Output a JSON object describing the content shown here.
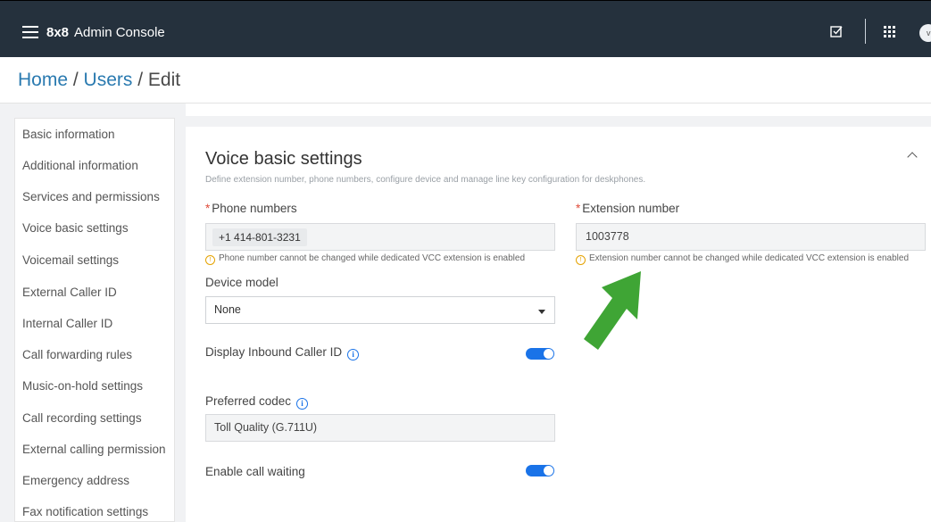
{
  "header": {
    "brand_bold": "8x8",
    "brand_name": "Admin Console",
    "avatar_initial": "v"
  },
  "breadcrumb": {
    "home": "Home",
    "users": "Users",
    "sep": " / ",
    "current": "Edit"
  },
  "sidebar": {
    "items": [
      {
        "label": "Basic information"
      },
      {
        "label": "Additional information"
      },
      {
        "label": "Services and permissions"
      },
      {
        "label": "Voice basic settings"
      },
      {
        "label": "Voicemail settings"
      },
      {
        "label": "External Caller ID"
      },
      {
        "label": "Internal Caller ID"
      },
      {
        "label": "Call forwarding rules"
      },
      {
        "label": "Music-on-hold settings"
      },
      {
        "label": "Call recording settings"
      },
      {
        "label": "External calling permission"
      },
      {
        "label": "Emergency address"
      },
      {
        "label": "Fax notification settings"
      }
    ]
  },
  "section": {
    "title": "Voice basic settings",
    "description": "Define extension number, phone numbers, configure device and manage line key configuration for deskphones."
  },
  "fields": {
    "phone_numbers": {
      "required_mark": "*",
      "label": "Phone numbers",
      "value": "+1 414-801-3231",
      "warning": "Phone number cannot be changed while dedicated VCC extension is enabled"
    },
    "extension_number": {
      "required_mark": "*",
      "label": "Extension number",
      "value": "1003778",
      "warning": "Extension number cannot be changed while dedicated VCC extension is enabled"
    },
    "device_model": {
      "label": "Device model",
      "value": "None"
    },
    "display_inbound_caller_id": {
      "label": "Display Inbound Caller ID",
      "enabled": true
    },
    "preferred_codec": {
      "label": "Preferred codec",
      "value": "Toll Quality (G.711U)"
    },
    "enable_call_waiting": {
      "label": "Enable call waiting",
      "enabled": true
    }
  },
  "colors": {
    "topbar": "#25313d",
    "accent_blue": "#1a73e8",
    "link": "#2a7ab0",
    "warning": "#e5a200",
    "annotation_arrow": "#3fa535"
  },
  "icons": {
    "menu": "hamburger-icon",
    "tasks": "checkbox-icon",
    "apps": "grid-icon",
    "collapse": "chevron-up-icon",
    "info": "info-icon",
    "warning": "warning-icon",
    "annotation": "green-arrow"
  }
}
